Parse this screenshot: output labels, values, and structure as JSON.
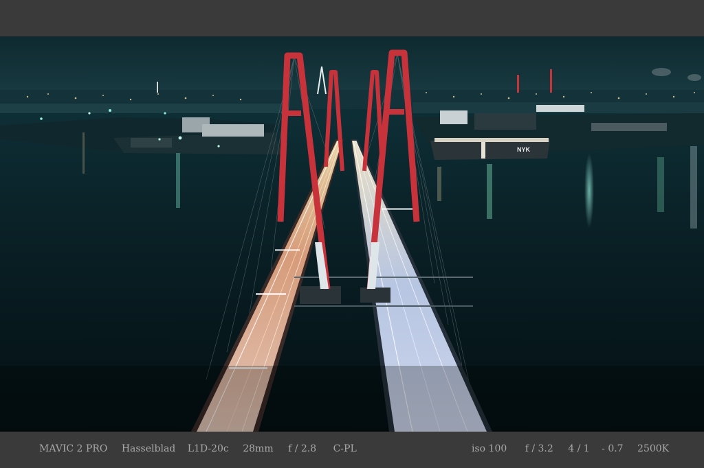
{
  "exif": {
    "left": [
      "MAVIC 2 PRO",
      "Hasselblad",
      "L1D-20c",
      "28mm",
      "f / 2.8",
      "C-PL"
    ],
    "right": [
      "iso 100",
      "f / 3.2",
      "4 / 1",
      "- 0.7",
      "2500K"
    ]
  },
  "photo": {
    "ship_label": "NYK"
  },
  "colors": {
    "frame": "#3a3a3a",
    "caption_text": "#a8a8a8",
    "pylon_red": "#c8323a",
    "water": "#06171c"
  }
}
